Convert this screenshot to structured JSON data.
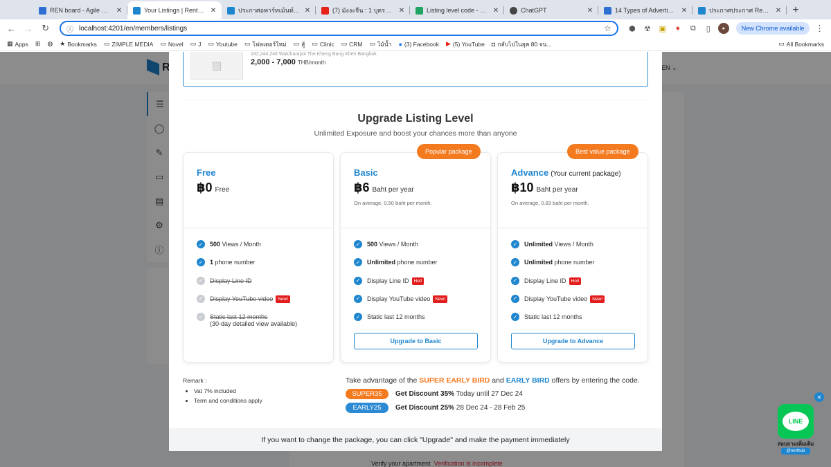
{
  "browser": {
    "tabs": [
      {
        "title": "REN board - Agile Board -",
        "color": "#2d6fd2",
        "active": false
      },
      {
        "title": "Your Listings | RentHub.in",
        "color": "#1e86cf",
        "active": true
      },
      {
        "title": "ประกาศอพาร์ทเม้นท์ของคุณ",
        "color": "#1e86cf",
        "active": false
      },
      {
        "title": "(7) มังงะจีน : 1 บุตรแห่งเทพเ",
        "color": "#e62117",
        "active": false
      },
      {
        "title": "Listing level code - Goog",
        "color": "#1fa463",
        "active": false
      },
      {
        "title": "ChatGPT",
        "color": "#444444",
        "active": false
      },
      {
        "title": "14 Types of Advertising |",
        "color": "#2d6fd2",
        "active": false
      },
      {
        "title": "ประกาศประกาศ RentHub |",
        "color": "#1e86cf",
        "active": false
      }
    ],
    "url": "localhost:4201/en/members/listings",
    "new_chrome": "New Chrome available",
    "bookmarks": [
      "Apps",
      "Bookmarks",
      "ZIMPLE MEDIA",
      "Novel",
      "J",
      "Youtube",
      "โฟลเดอร์ใหม่",
      "สู้",
      "Clinic",
      "CRM",
      "ไม้น้ำ",
      "(3) Facebook",
      "(5) YouTube",
      "กลับไปในยุค 80 จน..."
    ],
    "all_bookmarks": "All Bookmarks"
  },
  "background": {
    "logo_letter": "R",
    "lang": "EN",
    "verify_label": "Verify your apartment",
    "verify_status": "Verification is incomplete"
  },
  "listing": {
    "address": "242,244,246 Watcharapol The Kheng Bang Khen Bangkok",
    "price": "2,000 - 7,000",
    "price_unit": "THB/month"
  },
  "upgrade": {
    "title": "Upgrade Listing Level",
    "subtitle": "Unlimited Exposure and boost your chances more than anyone",
    "popular_label": "Popular package",
    "best_label": "Best value package",
    "free": {
      "name": "Free",
      "price": "฿0",
      "price_unit": "Free",
      "features": [
        {
          "bold": "500",
          "text": " Views / Month"
        },
        {
          "bold": "1",
          "text": " phone number"
        },
        {
          "text": "Display Line ID"
        },
        {
          "text": "Display YouTube video",
          "badge": "New!"
        },
        {
          "text": "Static last 12 months",
          "sub": "(30-day detailed view available)"
        }
      ]
    },
    "basic": {
      "name": "Basic",
      "price": "฿6",
      "price_unit": "Baht per year",
      "avg": "On average, 0.50 baht per month.",
      "features": [
        {
          "bold": "500",
          "text": " Views / Month"
        },
        {
          "bold": "Unlimited",
          "text": " phone number"
        },
        {
          "text": "Display Line ID",
          "badge": "Hot!"
        },
        {
          "text": "Display YouTube video",
          "badge": "New!"
        },
        {
          "text": "Static last 12 months"
        }
      ],
      "button": "Upgrade to Basic"
    },
    "advance": {
      "name": "Advance",
      "current_note": "(Your current package)",
      "price": "฿10",
      "price_unit": "Baht per year",
      "avg": "On average, 0.83 baht per month.",
      "features": [
        {
          "bold": "Unlimited",
          "text": " Views / Month"
        },
        {
          "bold": "Unlimited",
          "text": " phone number"
        },
        {
          "text": "Display Line ID",
          "badge": "Hot!"
        },
        {
          "text": "Display YouTube video",
          "badge": "New!"
        },
        {
          "text": "Static last 12 months"
        }
      ],
      "button": "Upgrade to Advance"
    }
  },
  "remark": {
    "title": "Remark :",
    "items": [
      "Vat 7% included",
      "Term and conditions apply"
    ]
  },
  "promo": {
    "prefix": "Take advantage of the ",
    "super": "SUPER EARLY BIRD",
    "and": " and ",
    "early": "EARLY BIRD",
    "suffix": " offers by entering the code.",
    "codes": [
      {
        "code": "SUPER35",
        "discount": "Get Discount 35%",
        "when": " Today until 27 Dec 24"
      },
      {
        "code": "EARLY25",
        "discount": "Get Discount 25%",
        "when": " 28 Dec 24 - 28 Feb 25"
      }
    ]
  },
  "footer": "If you want to change the package, you can click \"Upgrade\" and make the payment immediately",
  "line_widget": {
    "logo_text": "LINE",
    "caption": "สอบถามเพิ่มเติม",
    "handle": "@renthub"
  }
}
